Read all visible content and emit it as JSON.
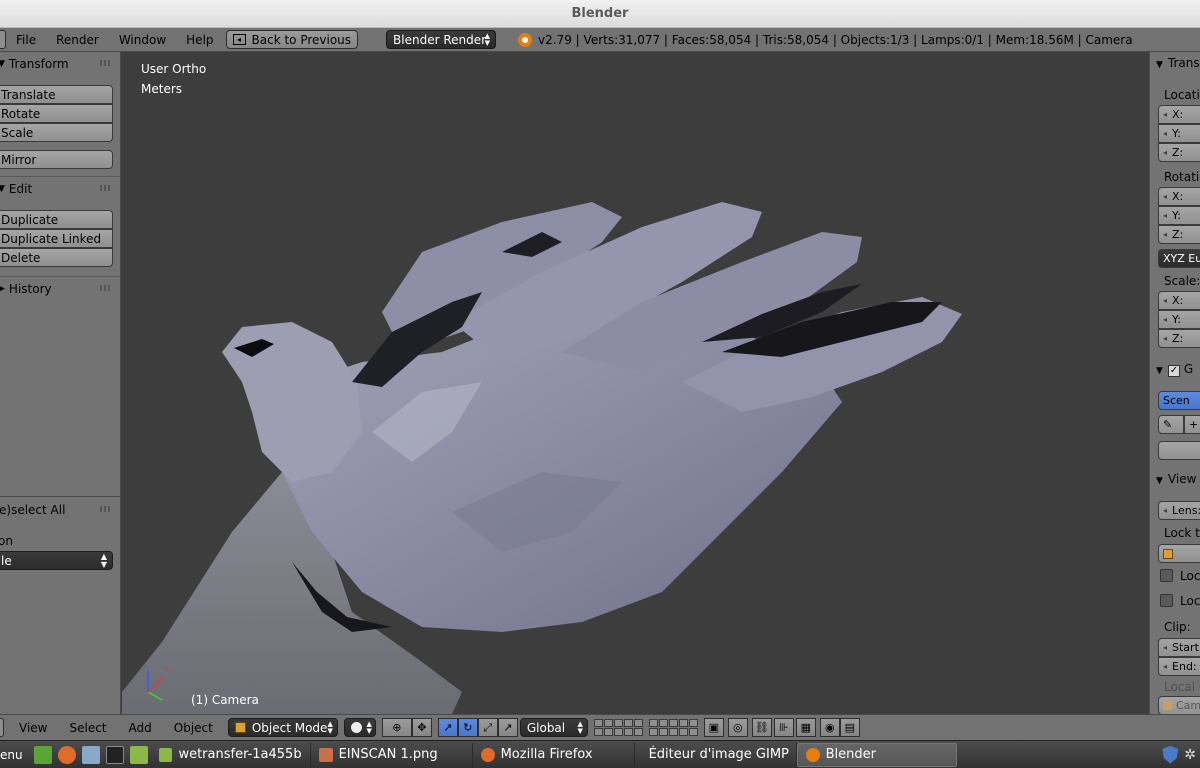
{
  "window": {
    "title": "Blender"
  },
  "info_header": {
    "menus": [
      "File",
      "Render",
      "Window",
      "Help"
    ],
    "back_button": "Back to Previous",
    "render_engine": "Blender Render",
    "stats": "v2.79 | Verts:31,077 | Faces:58,054 | Tris:58,054 | Objects:1/3 | Lamps:0/1 | Mem:18.56M | Camera"
  },
  "tool_shelf": {
    "transform": {
      "title": "Transform",
      "buttons": [
        "Translate",
        "Rotate",
        "Scale",
        "Mirror"
      ]
    },
    "edit": {
      "title": "Edit",
      "buttons": [
        "Duplicate",
        "Duplicate Linked",
        "Delete"
      ]
    },
    "history": {
      "title": "History"
    },
    "operator": {
      "title": "e)select All",
      "label": "on",
      "dropdown": "le"
    }
  },
  "viewport": {
    "view_name": "User Ortho",
    "units": "Meters",
    "object_label": "(1) Camera",
    "mesh_color": "#8d8ea6"
  },
  "properties": {
    "transform_title": "Trans",
    "location_label": "Locatio",
    "rotation_label": "Rotatio",
    "scale_label": "Scale:",
    "axis_x": "X:",
    "axis_y": "Y:",
    "axis_z": "Z:",
    "rotation_mode": "XYZ Eu",
    "grease_title": "G",
    "scene_button": "Scen",
    "view_title": "View",
    "lens_label": "Lens:",
    "lock_label": "Lock to",
    "lock_check_1": "Loc",
    "lock_check_2": "Loc",
    "clip_label": "Clip:",
    "clip_start": "Start:",
    "clip_end": "End:",
    "local_camera_label": "Local C",
    "camera_field": "Cam"
  },
  "view_header": {
    "menus": [
      "View",
      "Select",
      "Add",
      "Object"
    ],
    "mode": "Object Mode",
    "orientation": "Global"
  },
  "taskbar": {
    "menu_label": "enu",
    "tasks": [
      "wetransfer-1a455b",
      "EINSCAN 1.png",
      "Mozilla Firefox",
      "Éditeur d'image GIMP",
      "Blender"
    ]
  }
}
